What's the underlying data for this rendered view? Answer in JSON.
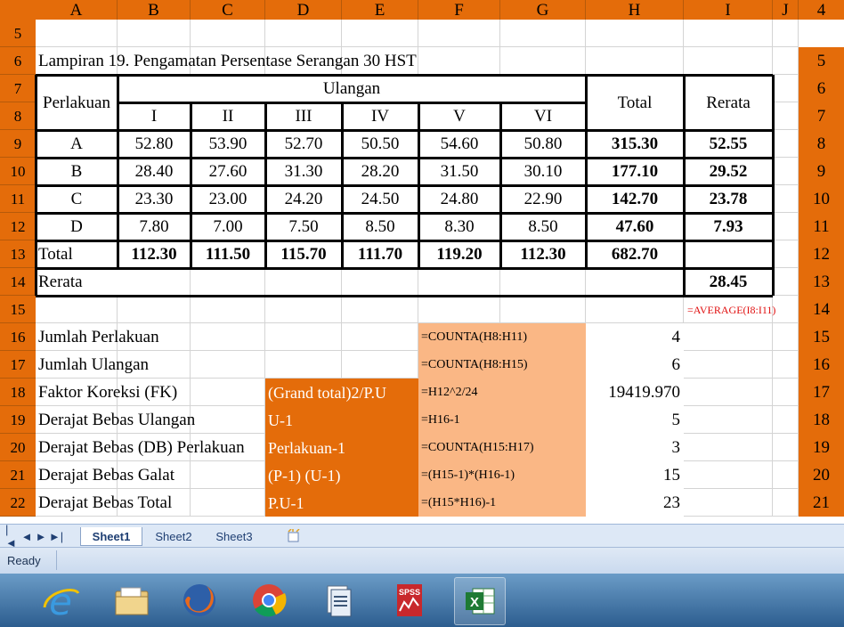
{
  "columns": [
    {
      "letter": "A"
    },
    {
      "letter": "B"
    },
    {
      "letter": "C"
    },
    {
      "letter": "D"
    },
    {
      "letter": "E"
    },
    {
      "letter": "F"
    },
    {
      "letter": "G"
    },
    {
      "letter": "H"
    },
    {
      "letter": "I"
    },
    {
      "letter": "J"
    }
  ],
  "column_right_numbers": [
    "4",
    "5",
    "6",
    "7",
    "8",
    "9",
    "10",
    "11",
    "12",
    "13",
    "14",
    "15",
    "16",
    "17",
    "18",
    "19",
    "20",
    "21"
  ],
  "row_numbers": [
    "5",
    "6",
    "7",
    "8",
    "9",
    "10",
    "11",
    "12",
    "13",
    "14",
    "15",
    "16",
    "17",
    "18",
    "19",
    "20",
    "21",
    "22"
  ],
  "title": "Lampiran 19. Pengamatan Persentase Serangan 30 HST",
  "header": {
    "perlakuan": "Perlakuan",
    "ulangan": "Ulangan",
    "reps": [
      "I",
      "II",
      "III",
      "IV",
      "V",
      "VI"
    ],
    "total": "Total",
    "rerata": "Rerata"
  },
  "data_rows": [
    {
      "label": "A",
      "values": [
        "52.80",
        "53.90",
        "52.70",
        "50.50",
        "54.60",
        "50.80"
      ],
      "total": "315.30",
      "mean": "52.55"
    },
    {
      "label": "B",
      "values": [
        "28.40",
        "27.60",
        "31.30",
        "28.20",
        "31.50",
        "30.10"
      ],
      "total": "177.10",
      "mean": "29.52"
    },
    {
      "label": "C",
      "values": [
        "23.30",
        "23.00",
        "24.20",
        "24.50",
        "24.80",
        "22.90"
      ],
      "total": "142.70",
      "mean": "23.78"
    },
    {
      "label": "D",
      "values": [
        "7.80",
        "7.00",
        "7.50",
        "8.50",
        "8.30",
        "8.50"
      ],
      "total": "47.60",
      "mean": "7.93"
    }
  ],
  "total_row": {
    "label": "Total",
    "values": [
      "112.30",
      "111.50",
      "115.70",
      "111.70",
      "119.20",
      "112.30"
    ],
    "grand": "682.70"
  },
  "rerata_row": {
    "label": "Rerata",
    "value": "28.45"
  },
  "average_formula": "=AVERAGE(I8:I11)",
  "anova": [
    {
      "label": "Jumlah Perlakuan",
      "formula": "=COUNTA(H8:H11)",
      "value": "4",
      "note": ""
    },
    {
      "label": "Jumlah Ulangan",
      "formula": "=COUNTA(H8:H15)",
      "value": "6",
      "note": ""
    },
    {
      "label": "Faktor Koreksi (FK)",
      "formula": "=H12^2/24",
      "value": "19419.970",
      "note": "(Grand total)2/P.U"
    },
    {
      "label": "Derajat Bebas Ulangan",
      "formula": "=H16-1",
      "value": "5",
      "note": "U-1"
    },
    {
      "label": "Derajat Bebas (DB) Perlakuan",
      "formula": "=COUNTA(H15:H17)",
      "value": "3",
      "note": "Perlakuan-1"
    },
    {
      "label": "Derajat Bebas Galat",
      "formula": "=(H15-1)*(H16-1)",
      "value": "15",
      "note": "(P-1) (U-1)"
    },
    {
      "label": "Derajat Bebas Total",
      "formula": "=(H15*H16)-1",
      "value": "23",
      "note": "P.U-1"
    }
  ],
  "sheet_tabs": [
    "Sheet1",
    "Sheet2",
    "Sheet3"
  ],
  "tab_nav": [
    "first-sheet",
    "prev-sheet",
    "next-sheet",
    "last-sheet"
  ],
  "status": "Ready",
  "taskbar": [
    {
      "name": "internet-explorer-icon"
    },
    {
      "name": "file-explorer-icon"
    },
    {
      "name": "firefox-icon"
    },
    {
      "name": "chrome-icon"
    },
    {
      "name": "document-app-icon"
    },
    {
      "name": "spss-icon",
      "label": "SPSS"
    },
    {
      "name": "excel-icon"
    }
  ],
  "colors": {
    "header_orange": "#e46c0a",
    "peach": "#fab785",
    "formula_red": "#e01010"
  }
}
